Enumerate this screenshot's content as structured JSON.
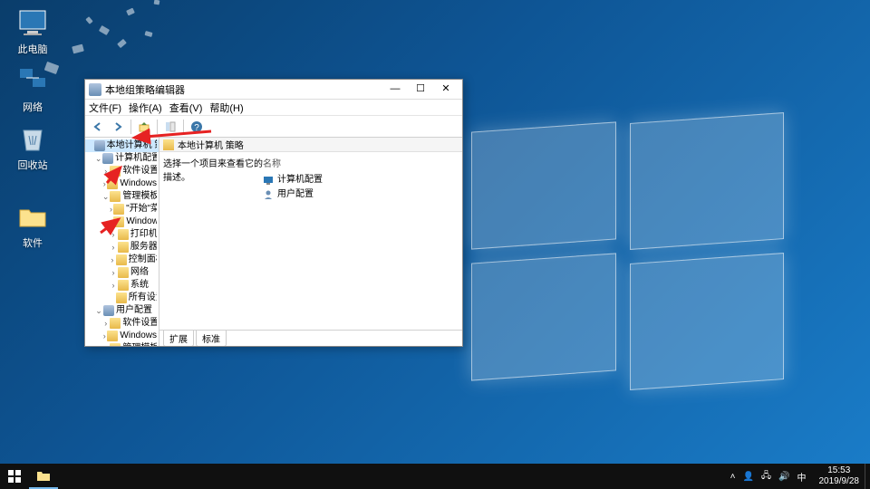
{
  "desktop": {
    "icons": [
      {
        "name": "this-pc",
        "label": "此电脑"
      },
      {
        "name": "network",
        "label": "网络"
      },
      {
        "name": "recycle-bin",
        "label": "回收站"
      },
      {
        "name": "software",
        "label": "软件"
      }
    ]
  },
  "window": {
    "title": "本地组策略编辑器",
    "menu": {
      "file": "文件(F)",
      "action": "操作(A)",
      "view": "查看(V)",
      "help": "帮助(H)"
    },
    "tree": [
      {
        "indent": 0,
        "exp": "",
        "icon": "g",
        "label": "本地计算机 策略",
        "sel": true
      },
      {
        "indent": 1,
        "exp": "⌄",
        "icon": "g",
        "label": "计算机配置"
      },
      {
        "indent": 2,
        "exp": "›",
        "icon": "f",
        "label": "软件设置"
      },
      {
        "indent": 2,
        "exp": "›",
        "icon": "f",
        "label": "Windows 设置"
      },
      {
        "indent": 2,
        "exp": "⌄",
        "icon": "f",
        "label": "管理模板"
      },
      {
        "indent": 3,
        "exp": "›",
        "icon": "f",
        "label": "\"开始\"菜单和任"
      },
      {
        "indent": 3,
        "exp": "›",
        "icon": "f",
        "label": "Windows 组件"
      },
      {
        "indent": 3,
        "exp": "›",
        "icon": "f",
        "label": "打印机"
      },
      {
        "indent": 3,
        "exp": "›",
        "icon": "f",
        "label": "服务器"
      },
      {
        "indent": 3,
        "exp": "›",
        "icon": "f",
        "label": "控制面板"
      },
      {
        "indent": 3,
        "exp": "›",
        "icon": "f",
        "label": "网络"
      },
      {
        "indent": 3,
        "exp": "›",
        "icon": "f",
        "label": "系统"
      },
      {
        "indent": 3,
        "exp": "",
        "icon": "f",
        "label": "所有设置"
      },
      {
        "indent": 1,
        "exp": "⌄",
        "icon": "g",
        "label": "用户配置"
      },
      {
        "indent": 2,
        "exp": "›",
        "icon": "f",
        "label": "软件设置"
      },
      {
        "indent": 2,
        "exp": "›",
        "icon": "f",
        "label": "Windows 设置"
      },
      {
        "indent": 2,
        "exp": "›",
        "icon": "f",
        "label": "管理模板"
      }
    ],
    "path": "本地计算机 策略",
    "prompt": "选择一个项目来查看它的描述。",
    "list_header": "名称",
    "list": [
      {
        "label": "计算机配置"
      },
      {
        "label": "用户配置"
      }
    ],
    "tabs": {
      "extended": "扩展",
      "standard": "标准"
    }
  },
  "taskbar": {
    "time": "15:53",
    "date": "2019/9/28"
  }
}
